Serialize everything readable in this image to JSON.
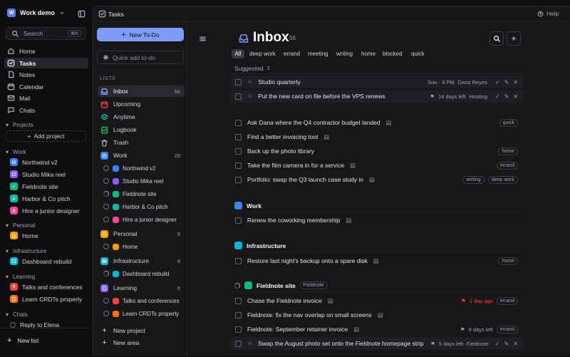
{
  "workspace": {
    "name": "Work demo",
    "initial": "W"
  },
  "search": {
    "label": "Search",
    "shortcut": "⌘K"
  },
  "nav": [
    "Home",
    "Tasks",
    "Notes",
    "Calendar",
    "Mail",
    "Chats"
  ],
  "sections": {
    "projects": "Projects",
    "add_project": "Add project",
    "work": "Work",
    "personal": "Personal",
    "infrastructure": "Infrastructure",
    "learning": "Learning",
    "chats": "Chats"
  },
  "work_items": [
    "Northwind v2",
    "Studio Mika reel",
    "Fieldnote site",
    "Harbor & Co pitch",
    "Hire a junior designer"
  ],
  "personal_items": [
    "Home"
  ],
  "infra_items": [
    "Dashboard rebuild"
  ],
  "learning_items": [
    "Talks and conferences",
    "Learn CRDTs properly"
  ],
  "chat_items": [
    "Reply to Elena"
  ],
  "new_list": "New list",
  "app": {
    "title": "Tasks",
    "help": "Help"
  },
  "lists_panel": {
    "new_todo": "New To-Do",
    "quick_add": "Quick add to-do",
    "lists_label": "LISTS",
    "lists": [
      {
        "label": "Inbox",
        "count": "56"
      },
      {
        "label": "Upcoming",
        "count": ""
      },
      {
        "label": "Anytime",
        "count": ""
      },
      {
        "label": "Logbook",
        "count": ""
      },
      {
        "label": "Trash",
        "count": ""
      }
    ],
    "work": {
      "label": "Work",
      "count": "28"
    },
    "work_sub": [
      "Northwind v2",
      "Studio Mika reel",
      "Fieldnote site",
      "Harbor & Co pitch",
      "Hire a junior designer"
    ],
    "personal": {
      "label": "Personal",
      "count": "9"
    },
    "personal_sub": [
      "Home"
    ],
    "infrastructure": {
      "label": "Infrastructure",
      "count": "8"
    },
    "infra_sub": [
      "Dashboard rebuild"
    ],
    "learning": {
      "label": "Learning",
      "count": "6"
    },
    "learning_sub": [
      "Talks and conferences",
      "Learn CRDTs properly"
    ],
    "new_project": "New project",
    "new_area": "New area"
  },
  "inbox": {
    "title": "Inbox",
    "count": "56",
    "filters": [
      "All",
      "deep work",
      "errand",
      "meeting",
      "writing",
      "home",
      "blocked",
      "quick"
    ],
    "suggested_label": "Suggested",
    "suggested_count": "2",
    "suggested": [
      {
        "title": "Studio quarterly",
        "meta1": "Sun · 3 PM",
        "meta2": "Dana Reyes"
      },
      {
        "title": "Put the new card on file before the VPS renews",
        "meta1": "14 days left",
        "meta2": "Hosting"
      }
    ],
    "tasks": [
      {
        "title": "Ask Dana where the Q4 contractor budget landed",
        "tags": [
          "quick"
        ]
      },
      {
        "title": "Find a better invoicing tool",
        "tags": []
      },
      {
        "title": "Back up the photo library",
        "tags": [
          "home"
        ]
      },
      {
        "title": "Take the film camera in for a service",
        "tags": [
          "errand"
        ]
      },
      {
        "title": "Portfolio: swap the Q3 launch case study in",
        "tags": [
          "writing",
          "deep work"
        ]
      }
    ],
    "work_header": "Work",
    "work_tasks": [
      {
        "title": "Renew the coworking membership"
      }
    ],
    "infra_header": "Infrastructure",
    "infra_tasks": [
      {
        "title": "Restore last night's backup onto a spare disk",
        "tag": "home"
      }
    ],
    "fieldnote_header": "Fieldnote site",
    "fieldnote_tag": "Fieldnote",
    "fieldnote_tasks": [
      {
        "title": "Chase the Fieldnote invoice",
        "due": "1 day ago",
        "tag": "errand"
      },
      {
        "title": "Fieldnote: fix the nav overlap on small screens",
        "due": "",
        "tag": ""
      },
      {
        "title": "Fieldnote: September retainer invoice",
        "due": "8 days left",
        "tag": "errand"
      }
    ],
    "fieldnote_suggested": {
      "title": "Swap the August photo set onto the Fieldnote homepage strip",
      "due": "5 days left",
      "tag": "Fieldnote"
    }
  },
  "colors": {
    "accent": "#7c9cf5",
    "work": "#3b82f6",
    "personal": "#f59e0b",
    "infra": "#06b6d4",
    "learning": "#8b5cf6",
    "red": "#ef4444"
  }
}
